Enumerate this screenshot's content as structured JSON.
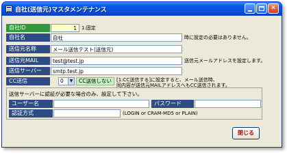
{
  "window": {
    "title": "自社(送信元)マスタメンテナンス",
    "minimize_glyph": "",
    "close_glyph": "✕"
  },
  "fields": {
    "company_id": {
      "label": "自社ID",
      "value": "1",
      "note": "1:固定"
    },
    "company_name": {
      "label": "自社名",
      "value": "自社",
      "note": "時に設定の必要はありません。"
    },
    "sender_name": {
      "label": "送信元名称",
      "value": "メール送信テスト(送信元)"
    },
    "sender_mail": {
      "label": "送信元MAIL",
      "value": "test@test.jp",
      "note": "送信元メールアドレスを設定します。"
    },
    "smtp_server": {
      "label": "送信サーバー",
      "value": "smtp.test.jp"
    },
    "cc_send": {
      "label": "CC送信",
      "select_value": "0",
      "status": "CC送信しない",
      "note_line1": "[1:CC送信する]に設定すると、メール送信時、",
      "note_line2": "同内容が送信元MAILアドレスへもCC送信されます。"
    }
  },
  "auth_group": {
    "description": "送信サーバーに認証が必要な場合のみ、設定して下さい。",
    "username_label": "ユーザー名",
    "username_value": "",
    "password_label": "パスワード",
    "password_value": "",
    "auth_method_label": "認証方式",
    "auth_method_value": "",
    "auth_method_note": "(LOGIN or CRAM-MD5 or PLAIN)"
  },
  "buttons": {
    "close_label": "閉じる"
  },
  "colors": {
    "label_bg": "#2e4b84",
    "key_label_bg": "#2f9a3b",
    "required_input_bg": "#ffffc8",
    "cc_status_bg": "#c8f0c0",
    "titlebar": "#0a4fd8"
  }
}
